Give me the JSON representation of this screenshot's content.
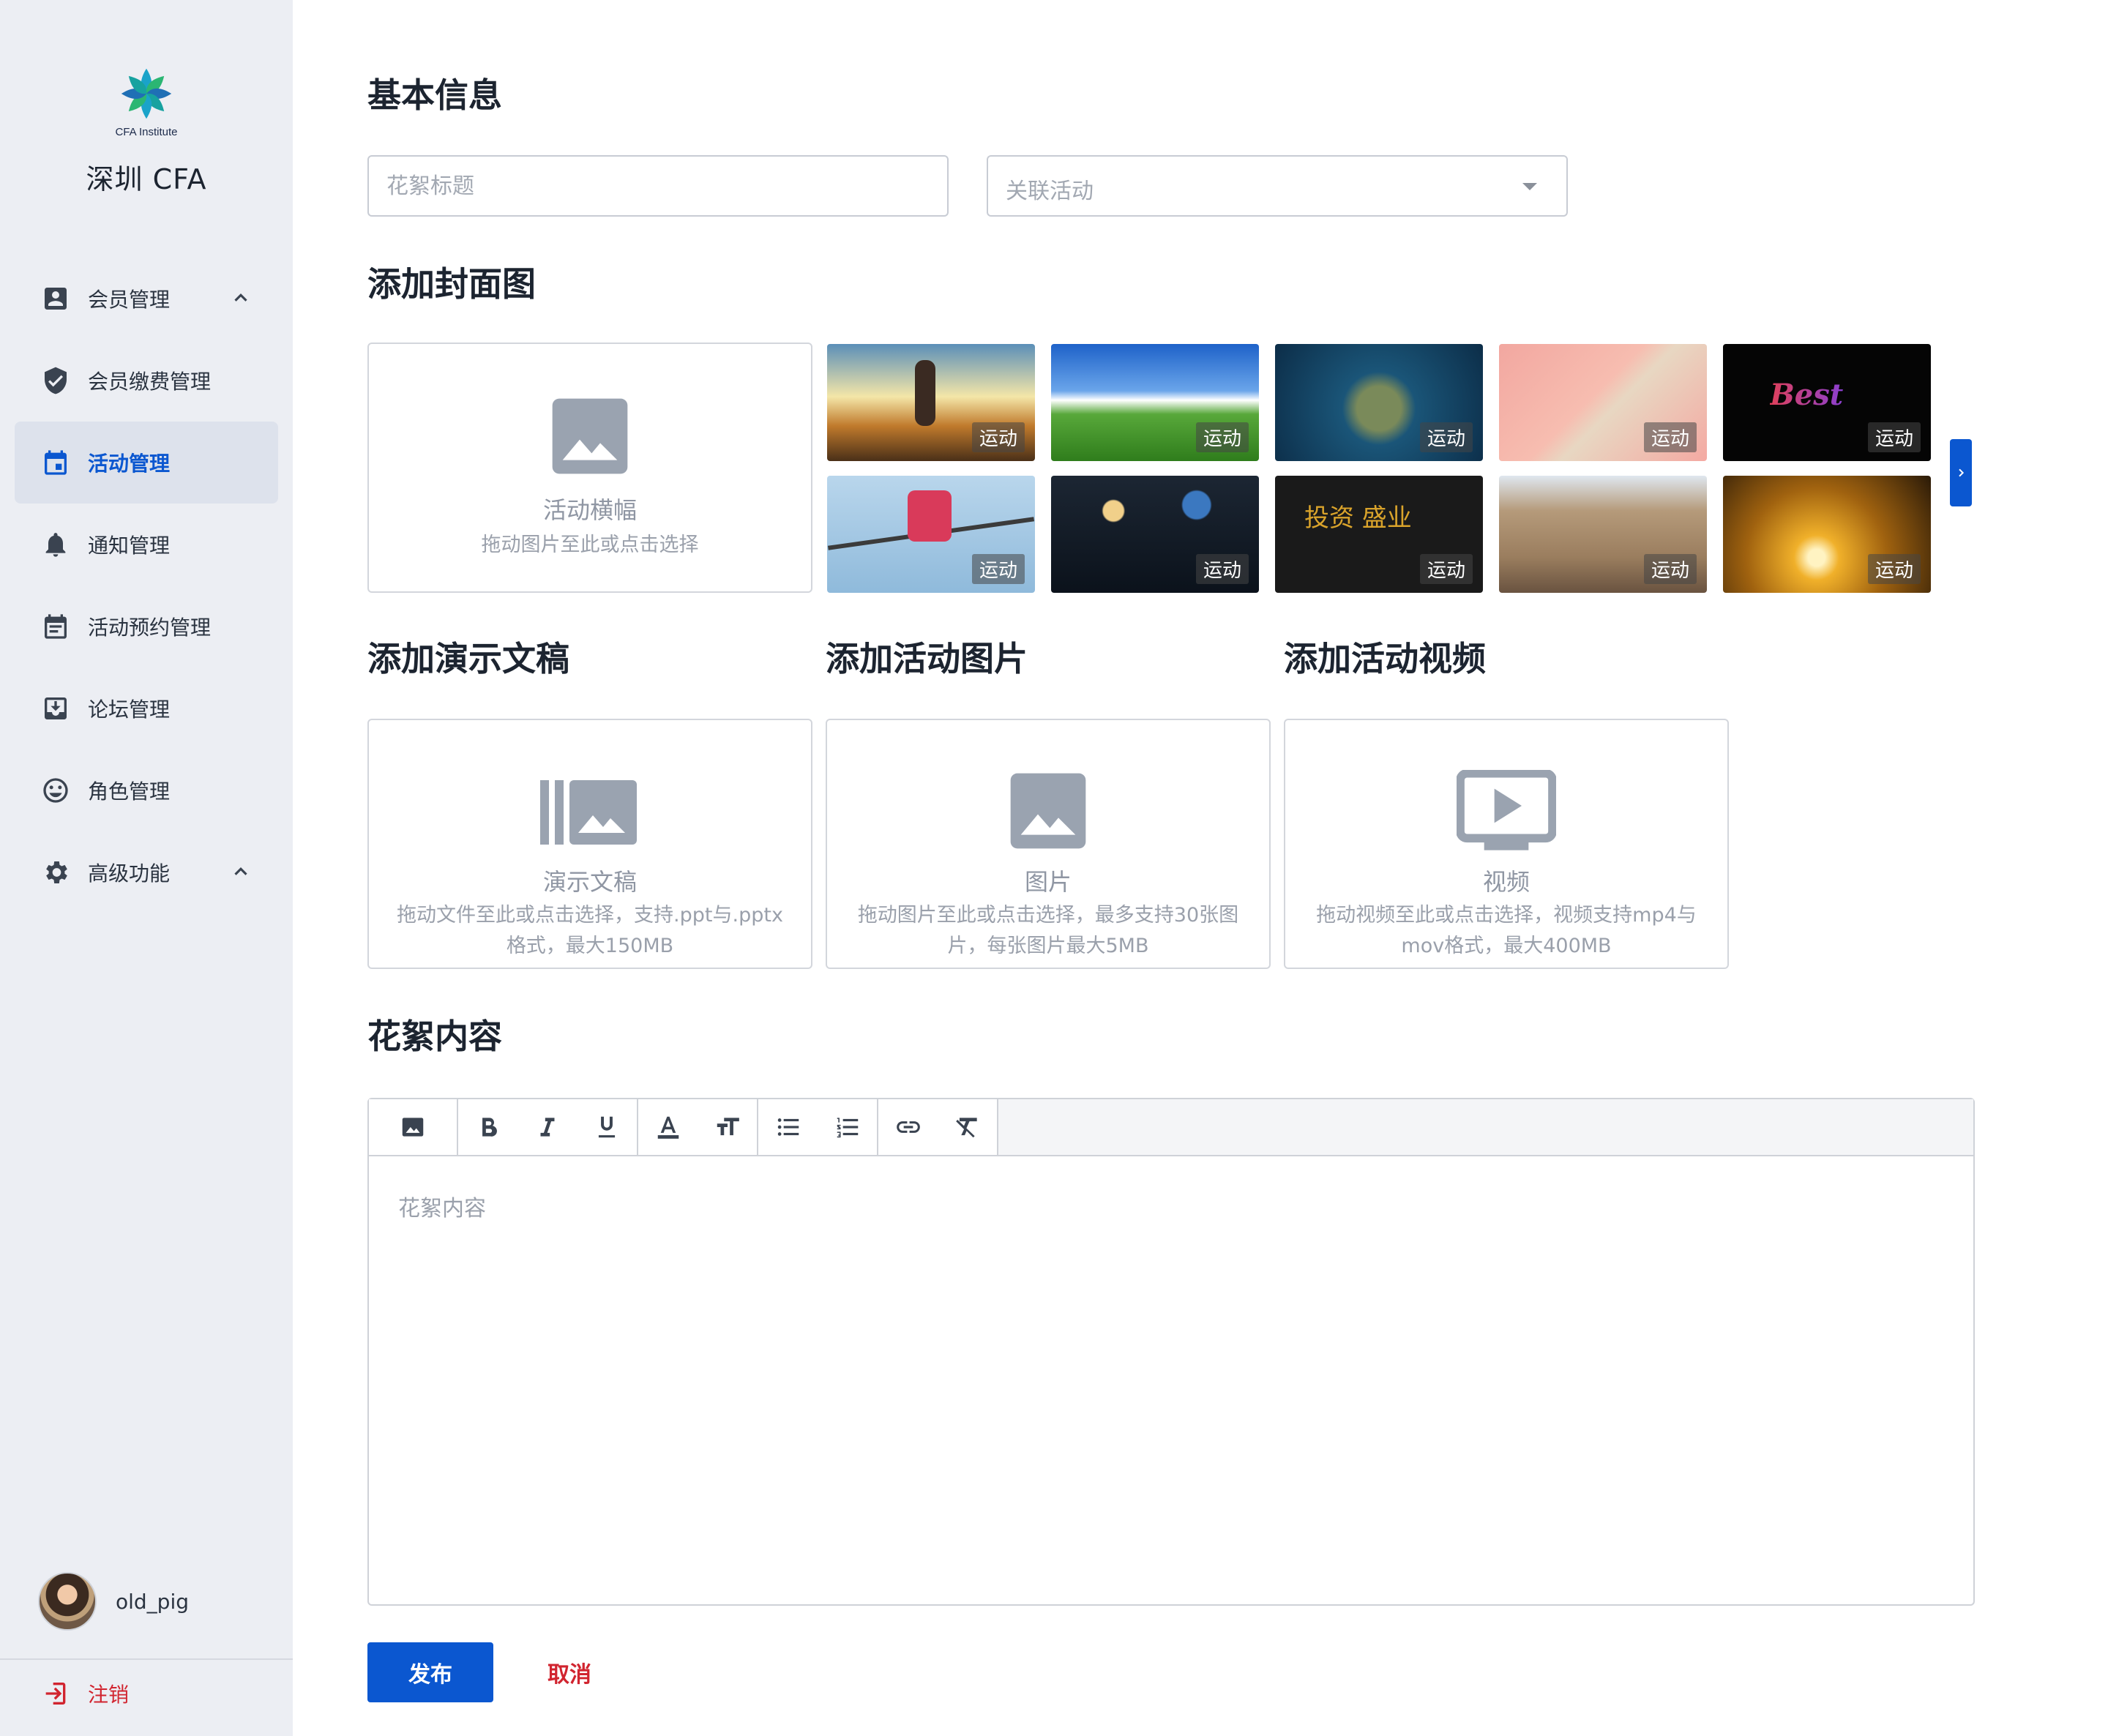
{
  "sidebar": {
    "logo_text": "CFA Institute",
    "brand": "深圳 CFA",
    "items": [
      {
        "label": "会员管理",
        "icon": "account-box-icon",
        "expandable": true
      },
      {
        "label": "会员缴费管理",
        "icon": "shield-check-icon"
      },
      {
        "label": "活动管理",
        "icon": "calendar-icon",
        "active": true
      },
      {
        "label": "通知管理",
        "icon": "bell-icon"
      },
      {
        "label": "活动预约管理",
        "icon": "calendar-list-icon"
      },
      {
        "label": "论坛管理",
        "icon": "inbox-download-icon"
      },
      {
        "label": "角色管理",
        "icon": "smiley-icon"
      },
      {
        "label": "高级功能",
        "icon": "gear-icon",
        "expandable": true
      }
    ],
    "user": {
      "name": "old_pig"
    },
    "logout_label": "注销"
  },
  "basic": {
    "heading": "基本信息",
    "title_placeholder": "花絮标题",
    "activity_placeholder": "关联活动"
  },
  "cover": {
    "heading": "添加封面图",
    "upload_title": "活动横幅",
    "upload_hint": "拖动图片至此或点击选择",
    "tag": "运动",
    "thumb_count": 10
  },
  "uploads": {
    "slides": {
      "heading": "添加演示文稿",
      "title": "演示文稿",
      "hint1": "拖动文件至此或点击选择，支持.ppt与.pptx",
      "hint2": "格式，最大150MB"
    },
    "images": {
      "heading": "添加活动图片",
      "title": "图片",
      "hint1": "拖动图片至此或点击选择，最多支持30张图",
      "hint2": "片，每张图片最大5MB"
    },
    "video": {
      "heading": "添加活动视频",
      "title": "视频",
      "hint1": "拖动视频至此或点击选择，视频支持mp4与",
      "hint2": "mov格式，最大400MB"
    }
  },
  "content": {
    "heading": "花絮内容",
    "placeholder": "花絮内容"
  },
  "actions": {
    "publish": "发布",
    "cancel": "取消"
  },
  "colors": {
    "accent": "#0b57d0",
    "danger": "#d1242f",
    "sidebar_bg": "#eceef3"
  }
}
